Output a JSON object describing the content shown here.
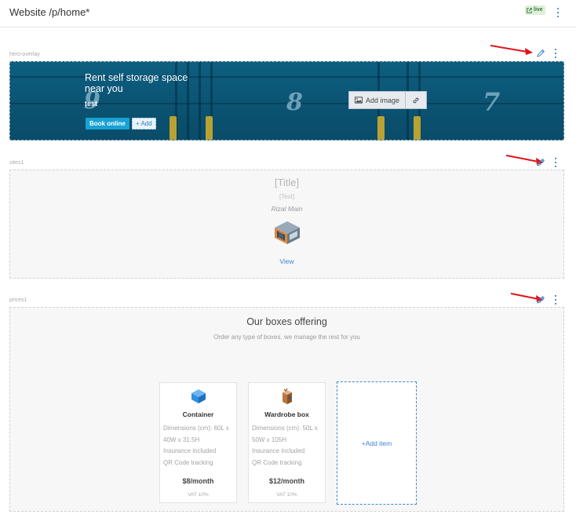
{
  "header": {
    "title": "Website /p/home*",
    "live_label": "live",
    "live_icon": "external-link-icon",
    "menu_icon": "more-vertical-icon"
  },
  "sections": {
    "hero": {
      "label": "hero-overlay",
      "title": "Rent self storage space near you",
      "subtitle": "test",
      "book_button": "Book online",
      "add_button": "+ Add",
      "add_image_button": "Add image",
      "add_image_icon": "image-icon",
      "link_icon": "link-icon",
      "door_numbers": [
        "9",
        "8",
        "7"
      ],
      "edit_icon": "pencil-icon",
      "menu_icon": "more-vertical-icon"
    },
    "sites": {
      "label": "sites1",
      "title": "[Title]",
      "text": "[Text]",
      "location": "Rizal Main",
      "image_icon": "storage-building-icon",
      "view_link": "View",
      "edit_icon": "pencil-icon",
      "menu_icon": "more-vertical-icon"
    },
    "prices": {
      "label": "prices1",
      "title": "Our boxes offering",
      "subtitle": "Order any type of boxes, we manage the rest for you",
      "edit_icon": "pencil-icon",
      "menu_icon": "more-vertical-icon",
      "items": [
        {
          "icon": "container-box-icon",
          "name": "Container",
          "desc": [
            "Dimensions (cm): 60L x 40W x 31.5H",
            "Insurance included",
            "QR Code tracking"
          ],
          "price": "$8/month",
          "vat": "VAT 10%"
        },
        {
          "icon": "wardrobe-box-icon",
          "name": "Wardrobe box",
          "desc": [
            "Dimensions (cm): 50L x 50W x 105H",
            "Insurance included",
            "QR Code tracking"
          ],
          "price": "$12/month",
          "vat": "VAT 10%"
        }
      ],
      "add_item": "+Add item"
    }
  },
  "colors": {
    "accent": "#17a2d3",
    "link": "#3a86d6",
    "annotation_arrow": "#e0141b",
    "hero_bg": "#0b5575"
  }
}
